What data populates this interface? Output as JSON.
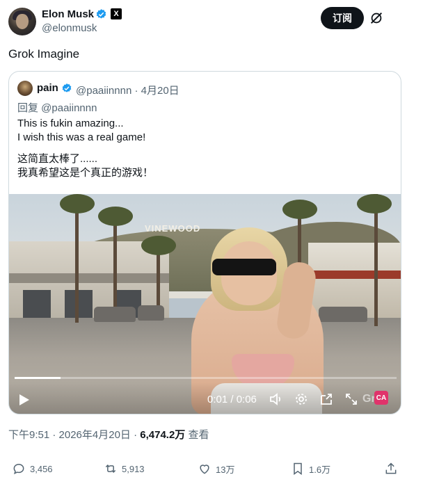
{
  "author": {
    "name": "Elon Musk",
    "handle": "@elonmusk",
    "badge_label": "X"
  },
  "subscribe_label": "订阅",
  "post_text": "Grok Imagine",
  "quote": {
    "name": "pain",
    "handle": "@paaiinnnn",
    "date": "· 4月20日",
    "reply_to": "回复 @paaiinnnn",
    "lines": [
      "This is fukin amazing...",
      "I wish this was a real game!",
      "这简直太棒了......",
      "我真希望这是个真正的游戏！"
    ]
  },
  "video": {
    "sign_text": "VINEWOOD",
    "time": "0:01 / 0:06",
    "watermark": "Grok",
    "badge": "CA",
    "progress": 0.12
  },
  "meta": {
    "time": "下午9:51 · 2026年4月20日 · ",
    "views": "6,474.2万",
    "views_suffix": " 查看"
  },
  "actions": {
    "replies": "3,456",
    "reposts": "5,913",
    "likes": "13万",
    "bookmarks": "1.6万"
  },
  "colors": {
    "verified": "#1d9bf0",
    "text_secondary": "#536471",
    "button": "#0f1419"
  }
}
